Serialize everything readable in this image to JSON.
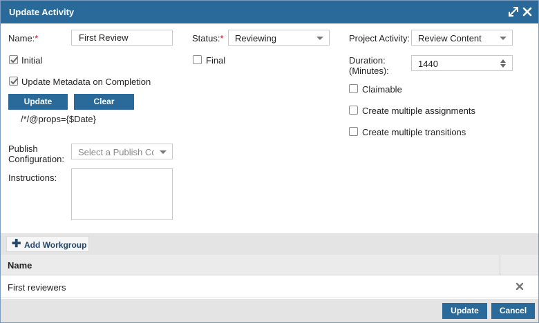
{
  "window": {
    "title": "Update Activity"
  },
  "form": {
    "name": {
      "label": "Name:",
      "required_mark": "*",
      "value": "First Review"
    },
    "initial": {
      "label": "Initial",
      "checked": true
    },
    "update_metadata": {
      "label": "Update Metadata on Completion",
      "checked": true
    },
    "update_button": "Update",
    "clear_button": "Clear",
    "metadata_expression": "/*/@props={$Date}",
    "publish_config": {
      "label_line1": "Publish",
      "label_line2": "Configuration:",
      "placeholder": "Select a Publish Cc"
    },
    "instructions": {
      "label": "Instructions:",
      "value": ""
    },
    "status": {
      "label": "Status:",
      "required_mark": "*",
      "value": "Reviewing"
    },
    "final": {
      "label": "Final",
      "checked": false
    },
    "project_activity": {
      "label": "Project Activity:",
      "value": "Review Content"
    },
    "duration": {
      "label_line1": "Duration:",
      "label_line2": "(Minutes):",
      "value": "1440"
    },
    "claimable": {
      "label": "Claimable",
      "checked": false
    },
    "multiple_assignments": {
      "label": "Create multiple assignments",
      "checked": false
    },
    "multiple_transitions": {
      "label": "Create multiple transitions",
      "checked": false
    }
  },
  "workgroups": {
    "add_button": "Add Workgroup",
    "columns": [
      "Name"
    ],
    "rows": [
      {
        "name": "First reviewers"
      }
    ]
  },
  "footer": {
    "update_button": "Update",
    "cancel_button": "Cancel"
  },
  "icons": {
    "expand": "expand-icon",
    "close": "close-icon",
    "plus": "plus-icon",
    "remove": "remove-icon",
    "check": "check-icon"
  },
  "colors": {
    "titlebar": "#2a6a9a",
    "primary_button": "#2a6a9a",
    "required": "#d0021b"
  }
}
